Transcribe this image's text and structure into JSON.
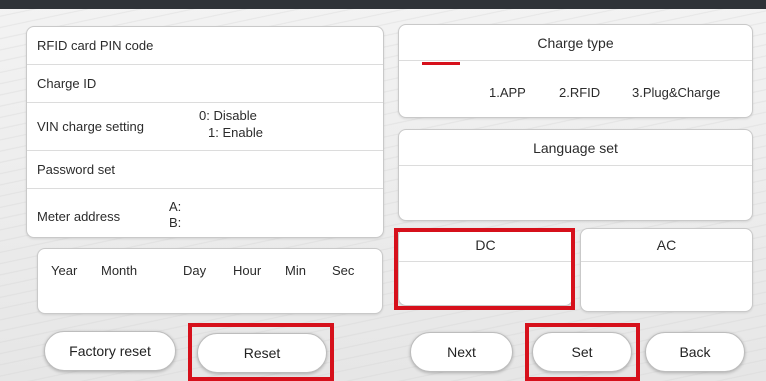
{
  "left_panel": {
    "rfid_pin_label": "RFID card PIN code",
    "charge_id_label": "Charge ID",
    "vin_label": "VIN charge setting",
    "vin_option_disable": "0: Disable",
    "vin_option_enable": "1: Enable",
    "password_label": "Password set",
    "meter_label": "Meter address",
    "meter_a": "A:",
    "meter_b": "B:"
  },
  "datetime": {
    "year": "Year",
    "month": "Month",
    "day": "Day",
    "hour": "Hour",
    "min": "Min",
    "sec": "Sec"
  },
  "charge_type": {
    "title": "Charge type",
    "options": [
      "1.APP",
      "2.RFID",
      "3.Plug&Charge"
    ],
    "indicator_color": "#d6101b"
  },
  "language": {
    "title": "Language set"
  },
  "dc": {
    "title": "DC"
  },
  "ac": {
    "title": "AC"
  },
  "buttons": {
    "factory_reset": "Factory reset",
    "reset": "Reset",
    "next": "Next",
    "set": "Set",
    "back": "Back"
  },
  "colors": {
    "highlight": "#d6101b",
    "top_bar": "#2f3338"
  }
}
